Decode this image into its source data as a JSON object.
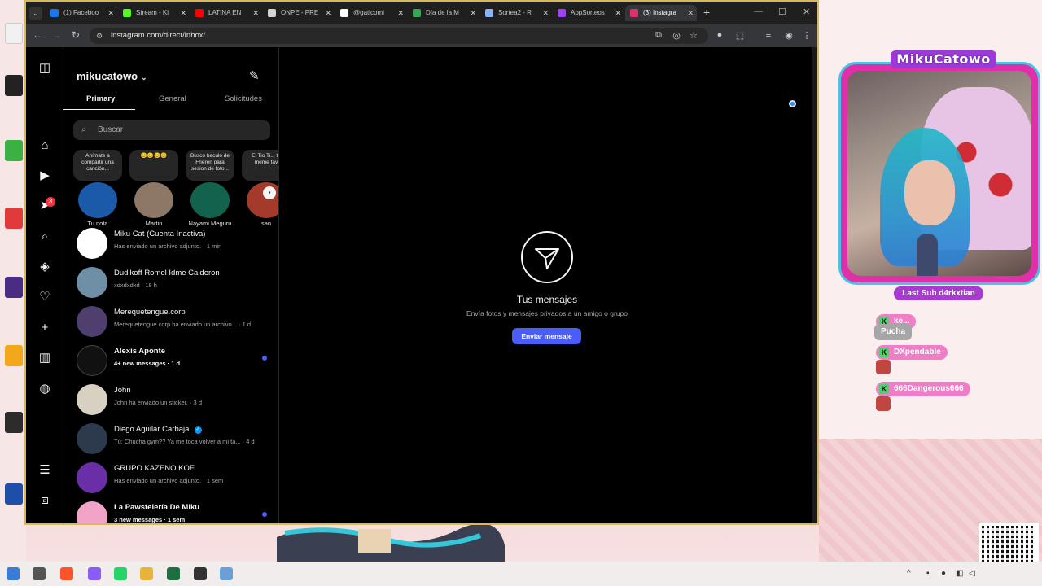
{
  "browser": {
    "tabs": [
      {
        "label": "(1) Faceboo",
        "color": "#1877f2"
      },
      {
        "label": "Stream - Ki",
        "color": "#53fc18"
      },
      {
        "label": "LATINA EN",
        "color": "#ff0000"
      },
      {
        "label": "ONPE - PRE",
        "color": "#d3d3d3"
      },
      {
        "label": "@gaticomi",
        "color": "#ffffff"
      },
      {
        "label": "Día de la M",
        "color": "#34a853"
      },
      {
        "label": "Sortea2 - R",
        "color": "#8ab4f8"
      },
      {
        "label": "AppSorteos",
        "color": "#a142f4"
      },
      {
        "label": "(3) Instagra",
        "color": "#e1306c"
      }
    ],
    "url": "instagram.com/direct/inbox/"
  },
  "instagram": {
    "username": "mikucatowo",
    "tabs": [
      "Primary",
      "General",
      "Solicitudes"
    ],
    "search_placeholder": "Buscar",
    "nav_badge": "3",
    "notes": [
      {
        "bubble": "Anímate a compartir una canción...",
        "name": "Tu nota",
        "color": "#1a5aa8"
      },
      {
        "bubble": "😊😊😊😊",
        "name": "Martin",
        "color": "#8d7766"
      },
      {
        "bubble": "Busco baculo de Frieren para sesion de foto...",
        "name": "Nayami Meguru",
        "color": "#13624d"
      },
      {
        "bubble": "El Tio Ti... tu meme fav",
        "name": "san",
        "color": "#a43a2c"
      }
    ],
    "threads": [
      {
        "name": "Miku Cat (Cuenta Inactiva)",
        "preview": "Has enviado un archivo adjunto. · 1 min",
        "unread": false,
        "color": "#ffffff"
      },
      {
        "name": "Dudikoff Romel Idme Calderon",
        "preview": "xdxdxdxd · 18 h",
        "unread": false,
        "color": "#6e8fa6"
      },
      {
        "name": "Merequetengue.corp",
        "preview": "Merequetengue.corp ha enviado un archivo... · 1 d",
        "unread": false,
        "color": "#4f3f6f"
      },
      {
        "name": "Alexis Aponte",
        "preview": "4+ new messages · 1 d",
        "unread": true,
        "color": "#111111"
      },
      {
        "name": "John",
        "preview": "John ha enviado un sticker. · 3 d",
        "unread": false,
        "color": "#d8d0c0"
      },
      {
        "name": "Diego Aguilar Carbajal",
        "preview": "Tú: Chucha gym?? Ya me toca volver a mi ta... · 4 d",
        "unread": false,
        "verified": true,
        "color": "#2d3a4d"
      },
      {
        "name": "GRUPO KAZENO KOE",
        "preview": "Has enviado un archivo adjunto. · 1 sem",
        "unread": false,
        "color": "#6a2ea6"
      },
      {
        "name": "La Pawstelería De Miku",
        "preview": "3 new messages · 1 sem",
        "unread": true,
        "color": "#f1a4c8"
      }
    ],
    "empty_state": {
      "title": "Tus mensajes",
      "subtitle": "Envía fotos y mensajes privados a un amigo o grupo",
      "button": "Enviar mensaje"
    }
  },
  "overlay": {
    "brand": "MikuCatowo",
    "last_sub_label": "Last Sub",
    "last_sub_name": "d4rkxtian",
    "chat": [
      {
        "user": "ke...",
        "text": "Pucha"
      },
      {
        "user": "DXpendable",
        "text": ""
      },
      {
        "user": "666Dangerous666",
        "text": ""
      }
    ]
  }
}
